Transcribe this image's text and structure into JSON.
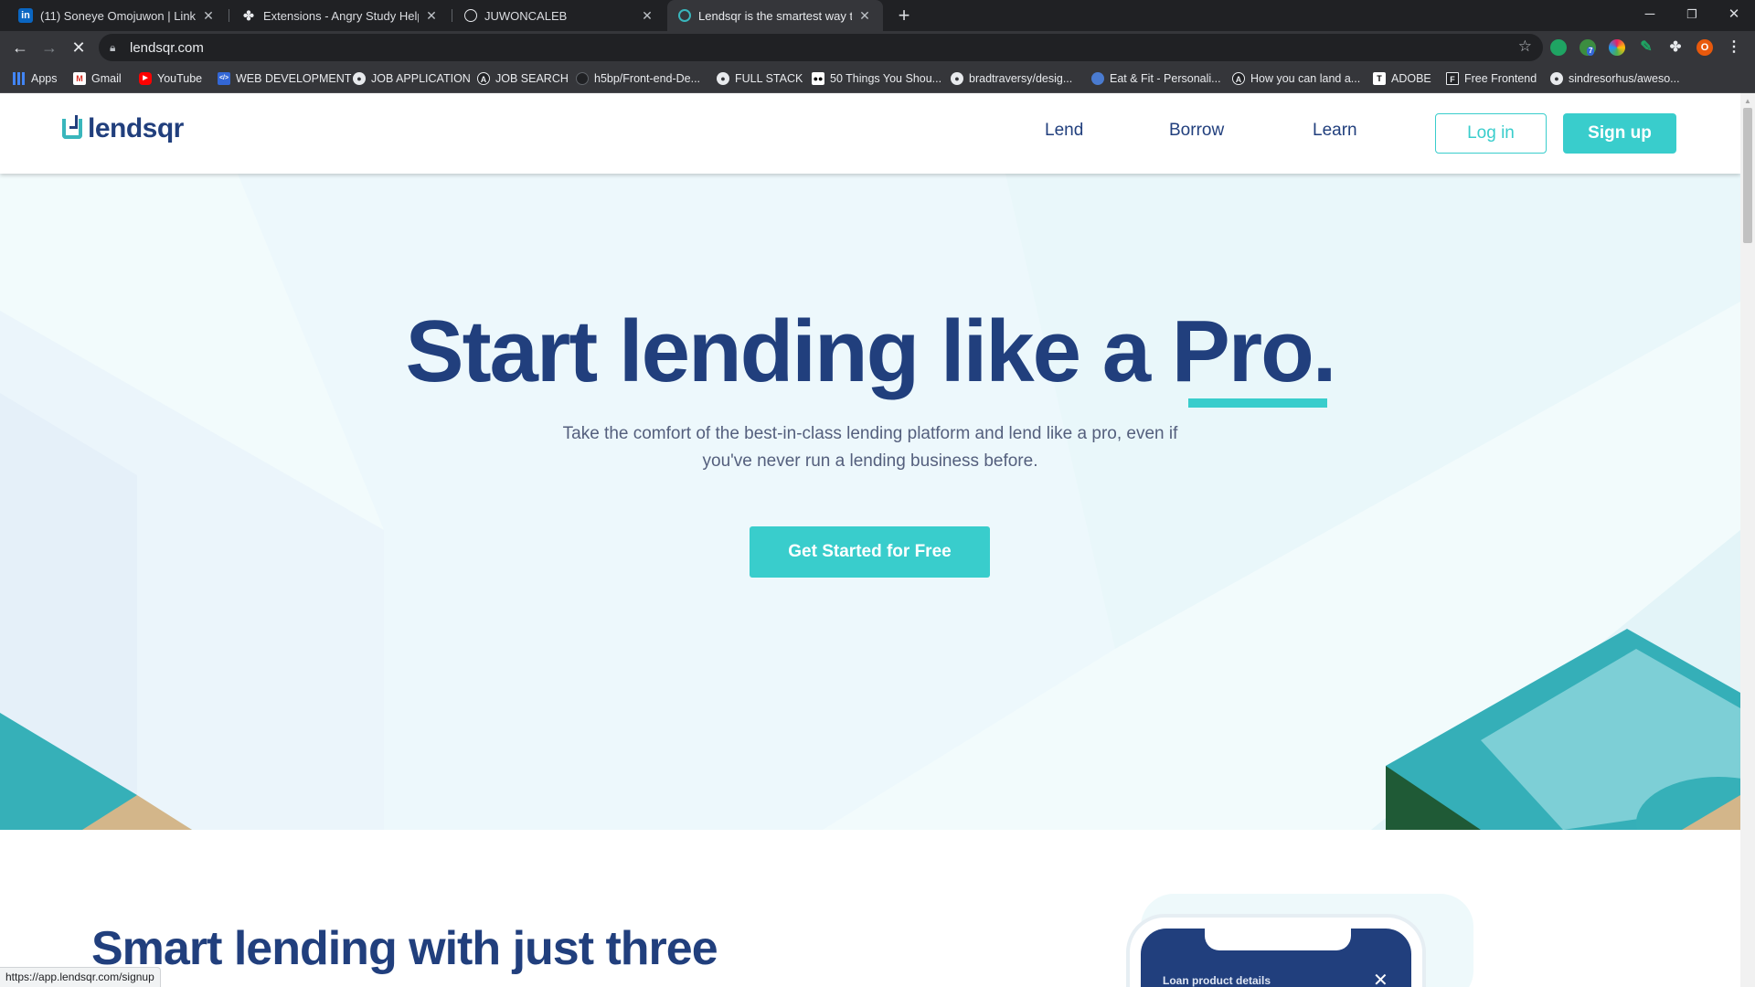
{
  "browser": {
    "tabs": [
      {
        "title": "(11) Soneye Omojuwon | LinkedIn",
        "icon": "linkedin-icon"
      },
      {
        "title": "Extensions - Angry Study Helper",
        "icon": "puzzle-icon"
      },
      {
        "title": "JUWONCALEB",
        "icon": "globe-icon"
      },
      {
        "title": "Lendsqr is the smartest way to le...",
        "icon": "lendsqr-icon"
      }
    ],
    "url": "lendsqr.com",
    "profile_initial": "O",
    "extension_badge": "7",
    "bookmarks": [
      {
        "label": "Apps",
        "icon": "apps-grid-icon"
      },
      {
        "label": "Gmail",
        "icon": "gmail-icon"
      },
      {
        "label": "YouTube",
        "icon": "youtube-icon"
      },
      {
        "label": "WEB DEVELOPMENT",
        "icon": "code-icon"
      },
      {
        "label": "JOB APPLICATION",
        "icon": "github-icon"
      },
      {
        "label": "JOB SEARCH",
        "icon": "a-logo-icon"
      },
      {
        "label": "h5bp/Front-end-De...",
        "icon": "github-icon"
      },
      {
        "label": "FULL STACK",
        "icon": "github-icon"
      },
      {
        "label": "50 Things You Shou...",
        "icon": "medium-icon"
      },
      {
        "label": "bradtraversy/desig...",
        "icon": "github-icon"
      },
      {
        "label": "Eat & Fit - Personali...",
        "icon": "globe-icon"
      },
      {
        "label": "How you can land a...",
        "icon": "a-logo-icon"
      },
      {
        "label": "ADOBE",
        "icon": "t-logo-icon"
      },
      {
        "label": "Free Frontend",
        "icon": "f-logo-icon"
      },
      {
        "label": "sindresorhus/aweso...",
        "icon": "github-icon"
      }
    ]
  },
  "site": {
    "logo_text": "lendsqr",
    "nav": {
      "lend": "Lend",
      "borrow": "Borrow",
      "learn": "Learn"
    },
    "login": "Log in",
    "signup": "Sign up"
  },
  "hero": {
    "headline": "Start lending like a Pro.",
    "subtext": "Take the comfort of the best-in-class lending platform and lend like a pro, even if you've never run a lending business before.",
    "cta": "Get Started for Free"
  },
  "section2": {
    "heading": "Smart lending with just three",
    "phone_title": "Loan product details"
  },
  "status_url": "https://app.lendsqr.com/signup",
  "colors": {
    "brand_navy": "#213f7d",
    "brand_teal": "#39cdcc",
    "hero_bg": "#f2fbfc"
  }
}
